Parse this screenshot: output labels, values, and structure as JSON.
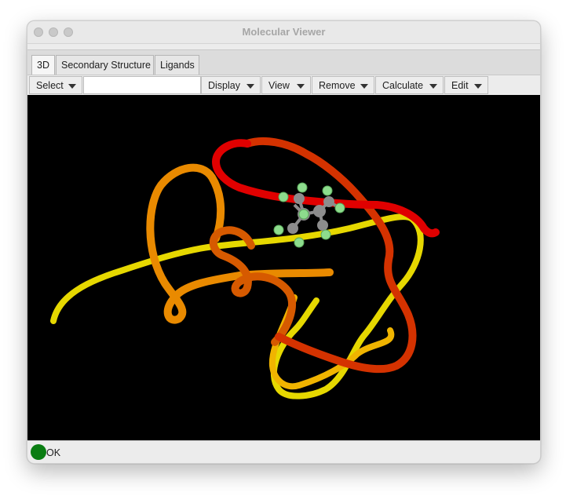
{
  "window": {
    "title": "Molecular Viewer"
  },
  "tabs": [
    {
      "label": "3D",
      "active": true
    },
    {
      "label": "Secondary Structure",
      "active": false
    },
    {
      "label": "Ligands",
      "active": false
    }
  ],
  "toolbar": {
    "select_label": "Select",
    "select_input_value": "",
    "display_label": "Display",
    "view_label": "View",
    "remove_label": "Remove",
    "calculate_label": "Calculate",
    "edit_label": "Edit"
  },
  "viewport": {
    "background": "#000000",
    "ribbon_colors": [
      "#e6d800",
      "#f0b400",
      "#e98a00",
      "#d65a00",
      "#d43200",
      "#e00000"
    ],
    "ligand_colors": {
      "carbon": "#8c8c8c",
      "fluorine": "#8ddc8d"
    }
  },
  "status": {
    "text": "OK",
    "indicator_color": "#0a7d12"
  }
}
